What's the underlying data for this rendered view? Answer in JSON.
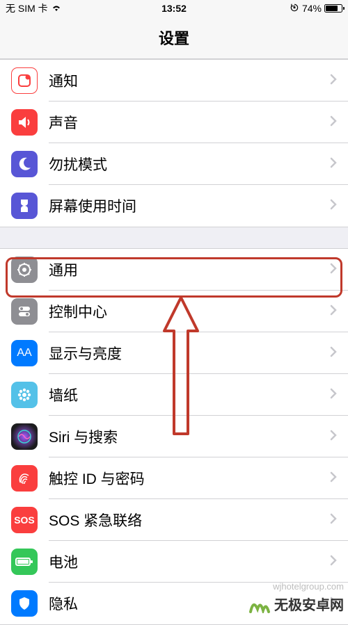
{
  "status": {
    "sim": "无 SIM 卡",
    "time": "13:52",
    "battery_pct": "74%"
  },
  "header": {
    "title": "设置"
  },
  "section1": [
    {
      "label": "通知",
      "icon": "notifications-icon",
      "color": "#fa3e3e"
    },
    {
      "label": "声音",
      "icon": "sound-icon",
      "color": "#fa3e3e"
    },
    {
      "label": "勿扰模式",
      "icon": "dnd-icon",
      "color": "#5856d6"
    },
    {
      "label": "屏幕使用时间",
      "icon": "screentime-icon",
      "color": "#5856d6"
    }
  ],
  "section2": [
    {
      "label": "通用",
      "icon": "general-icon",
      "color": "#8e8e93"
    },
    {
      "label": "控制中心",
      "icon": "control-center-icon",
      "color": "#8e8e93"
    },
    {
      "label": "显示与亮度",
      "icon": "display-icon",
      "color": "#007aff"
    },
    {
      "label": "墙纸",
      "icon": "wallpaper-icon",
      "color": "#54c1e8"
    },
    {
      "label": "Siri 与搜索",
      "icon": "siri-icon",
      "color": "#1c1c1e"
    },
    {
      "label": "触控 ID 与密码",
      "icon": "touchid-icon",
      "color": "#fa3e3e"
    },
    {
      "label": "SOS 紧急联络",
      "icon": "sos-icon",
      "color": "#fa3e3e",
      "text": "SOS"
    },
    {
      "label": "电池",
      "icon": "battery-icon",
      "color": "#34c759"
    },
    {
      "label": "隐私",
      "icon": "privacy-icon",
      "color": "#007aff"
    }
  ],
  "watermark": {
    "url": "wjhotelgroup.com",
    "brand": "无极安卓网"
  },
  "annotation": {
    "highlight_color": "#c0392b",
    "arrow_color": "#c0392b"
  }
}
